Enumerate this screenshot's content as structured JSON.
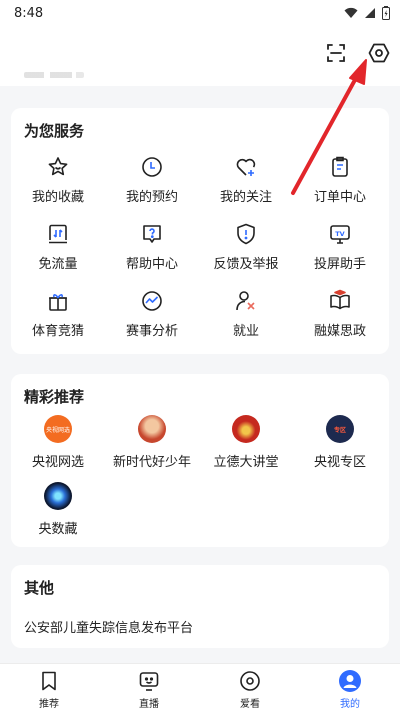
{
  "status_bar": {
    "time": "8:48"
  },
  "services": {
    "title": "为您服务",
    "items": [
      {
        "label": "我的收藏",
        "icon": "star-icon"
      },
      {
        "label": "我的预约",
        "icon": "clock-icon"
      },
      {
        "label": "我的关注",
        "icon": "heart-plus-icon"
      },
      {
        "label": "订单中心",
        "icon": "clipboard-icon"
      },
      {
        "label": "免流量",
        "icon": "data-free-icon"
      },
      {
        "label": "帮助中心",
        "icon": "help-icon"
      },
      {
        "label": "反馈及举报",
        "icon": "report-icon"
      },
      {
        "label": "投屏助手",
        "icon": "tv-cast-icon"
      },
      {
        "label": "体育竞猜",
        "icon": "gift-icon"
      },
      {
        "label": "赛事分析",
        "icon": "analysis-icon"
      },
      {
        "label": "就业",
        "icon": "job-icon"
      },
      {
        "label": "融媒思政",
        "icon": "book-icon"
      }
    ]
  },
  "recommend": {
    "title": "精彩推荐",
    "items": [
      {
        "label": "央视网选",
        "logo_color": "#f36c21",
        "logo_text": "央视网选"
      },
      {
        "label": "新时代好少年",
        "logo_color": "#c7472e",
        "logo_text": ""
      },
      {
        "label": "立德大讲堂",
        "logo_color": "#c5291f",
        "logo_text": ""
      },
      {
        "label": "央视专区",
        "logo_color": "#1d2a4f",
        "logo_text": "专区"
      },
      {
        "label": "央数藏",
        "logo_color": "#0d1830",
        "logo_text": ""
      }
    ]
  },
  "other": {
    "title": "其他",
    "link": "公安部儿童失踪信息发布平台"
  },
  "tabs": [
    {
      "label": "推荐",
      "icon": "bookmark-icon"
    },
    {
      "label": "直播",
      "icon": "live-tv-icon"
    },
    {
      "label": "爱看",
      "icon": "play-circle-icon"
    },
    {
      "label": "我的",
      "icon": "user-icon",
      "active": true
    }
  ],
  "colors": {
    "accent": "#2f6bff",
    "annotation_arrow": "#e2262b"
  }
}
